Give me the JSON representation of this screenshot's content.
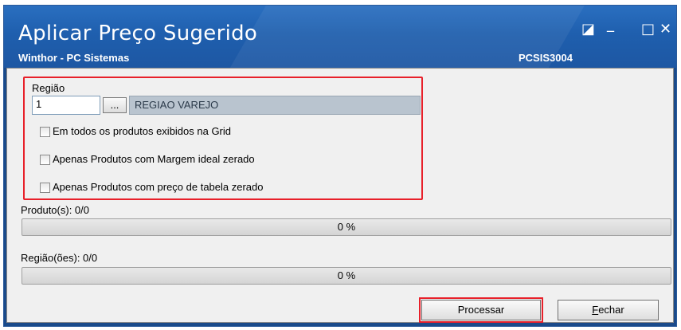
{
  "window": {
    "title": "Aplicar Preço Sugerido",
    "subtitle": "Winthor - PC Sistemas",
    "code": "PCSIS3004",
    "controls": {
      "restore": "◪",
      "minimize": "_",
      "maximize": "□",
      "close": "✕"
    }
  },
  "regiao": {
    "label": "Região",
    "code_value": "1",
    "lookup_button": "...",
    "name_value": "REGIAO VAREJO"
  },
  "options": [
    {
      "label": "Em todos os produtos exibidos na Grid",
      "checked": false
    },
    {
      "label": "Apenas Produtos com Margem ideal zerado",
      "checked": false
    },
    {
      "label": "Apenas Produtos com preço de tabela zerado",
      "checked": false
    }
  ],
  "progress": {
    "produtos": {
      "label": "Produto(s): 0/0",
      "percent_text": "0 %",
      "fraction": 0
    },
    "regioes": {
      "label": "Região(ões): 0/0",
      "percent_text": "0 %",
      "fraction": 0
    }
  },
  "buttons": {
    "processar": "Processar",
    "fechar_prefix": "",
    "fechar_accel": "F",
    "fechar_rest": "echar"
  },
  "colors": {
    "title_bg": "#1f5fae",
    "highlight": "#e8202a",
    "panel_bg": "#f0f0f0"
  }
}
